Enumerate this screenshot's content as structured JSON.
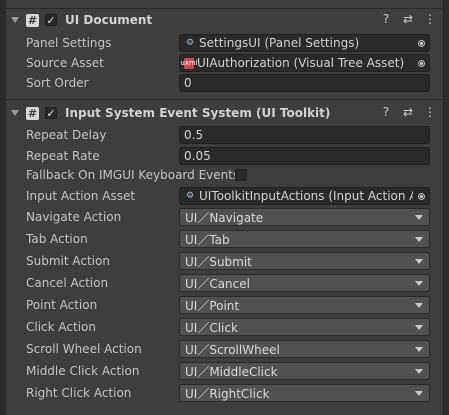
{
  "ui_document": {
    "title": "UI Document",
    "fields": {
      "panel_settings": {
        "label": "Panel Settings",
        "value": "SettingsUI (Panel Settings)"
      },
      "source_asset": {
        "label": "Source Asset",
        "value": "UIAuthorization (Visual Tree Asset)"
      },
      "sort_order": {
        "label": "Sort Order",
        "value": "0"
      }
    }
  },
  "event_system": {
    "title": "Input System Event System (UI Toolkit)",
    "fields": {
      "repeat_delay": {
        "label": "Repeat Delay",
        "value": "0.5"
      },
      "repeat_rate": {
        "label": "Repeat Rate",
        "value": "0.05"
      },
      "fallback_imgui": {
        "label": "Fallback On IMGUI Keyboard Events",
        "checked": false
      },
      "input_action_asset": {
        "label": "Input Action Asset",
        "value": "UIToolkitInputActions (Input Action Asset)"
      }
    },
    "actions": [
      {
        "label": "Navigate Action",
        "value": "UI／Navigate"
      },
      {
        "label": "Tab Action",
        "value": "UI／Tab"
      },
      {
        "label": "Submit Action",
        "value": "UI／Submit"
      },
      {
        "label": "Cancel Action",
        "value": "UI／Cancel"
      },
      {
        "label": "Point Action",
        "value": "UI／Point"
      },
      {
        "label": "Click Action",
        "value": "UI／Click"
      },
      {
        "label": "Scroll Wheel Action",
        "value": "UI／ScrollWheel"
      },
      {
        "label": "Middle Click Action",
        "value": "UI／MiddleClick"
      },
      {
        "label": "Right Click Action",
        "value": "UI／RightClick"
      }
    ]
  },
  "icons": {
    "help": "help-icon",
    "presets": "presets-icon",
    "menu": "context-menu-icon"
  }
}
